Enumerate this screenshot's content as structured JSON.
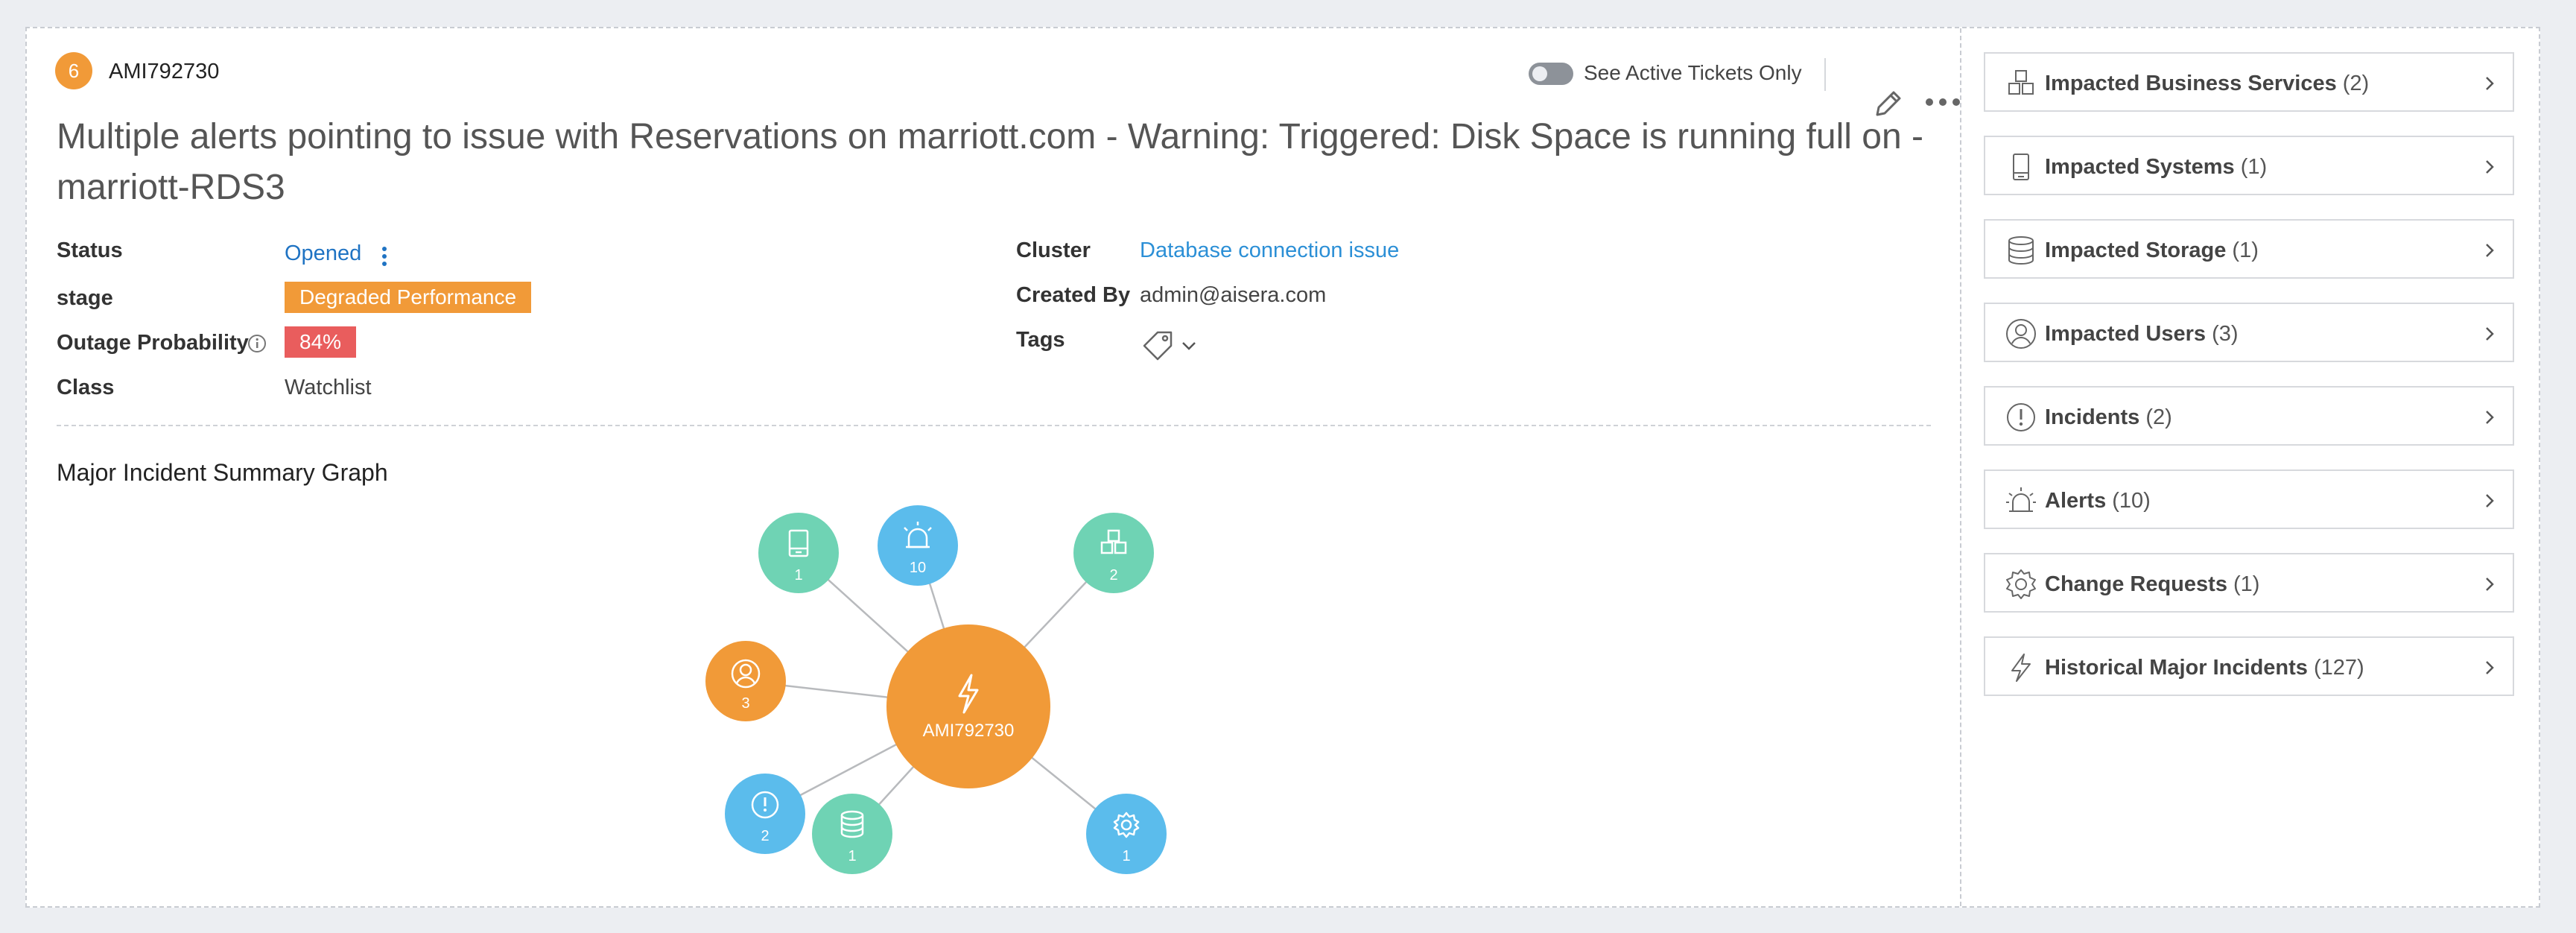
{
  "header": {
    "badge_count": "6",
    "ticket_id": "AMI792730",
    "toggle_label": "See Active Tickets Only",
    "title": "Multiple alerts pointing to issue with Reservations on marriott.com - Warning: Triggered: Disk Space is running full on - marriott-RDS3"
  },
  "fields": {
    "status_label": "Status",
    "status_value": "Opened",
    "stage_label": "stage",
    "stage_value": "Degraded Performance",
    "outage_label": "Outage Probability",
    "outage_value": "84%",
    "class_label": "Class",
    "class_value": "Watchlist",
    "cluster_label": "Cluster",
    "cluster_value": "Database connection issue",
    "created_by_label": "Created By",
    "created_by_value": "admin@aisera.com",
    "tags_label": "Tags"
  },
  "graph": {
    "title": "Major Incident Summary Graph",
    "center_label": "AMI792730",
    "nodes": [
      {
        "name": "systems",
        "icon": "system-icon",
        "count": "1",
        "color": "#6fd3b4"
      },
      {
        "name": "alerts",
        "icon": "alarm-icon",
        "count": "10",
        "color": "#5bbcec"
      },
      {
        "name": "business-services",
        "icon": "cubes-icon",
        "count": "2",
        "color": "#6fd3b4"
      },
      {
        "name": "users",
        "icon": "user-icon",
        "count": "3",
        "color": "#f19a38"
      },
      {
        "name": "incidents",
        "icon": "exclamation-icon",
        "count": "2",
        "color": "#5bbcec"
      },
      {
        "name": "storage",
        "icon": "database-icon",
        "count": "1",
        "color": "#6fd3b4"
      },
      {
        "name": "change-requests",
        "icon": "gear-icon",
        "count": "1",
        "color": "#5bbcec"
      }
    ]
  },
  "side": {
    "items": [
      {
        "label": "Impacted Business Services",
        "count": "(2)",
        "icon": "cubes-icon"
      },
      {
        "label": "Impacted Systems",
        "count": "(1)",
        "icon": "system-icon"
      },
      {
        "label": "Impacted Storage",
        "count": "(1)",
        "icon": "database-icon"
      },
      {
        "label": "Impacted Users",
        "count": "(3)",
        "icon": "user-icon"
      },
      {
        "label": "Incidents",
        "count": "(2)",
        "icon": "exclamation-icon"
      },
      {
        "label": "Alerts",
        "count": "(10)",
        "icon": "alarm-icon"
      },
      {
        "label": "Change Requests",
        "count": "(1)",
        "icon": "gear-icon"
      },
      {
        "label": "Historical Major Incidents",
        "count": "(127)",
        "icon": "lightning-icon"
      }
    ]
  },
  "colors": {
    "orange": "#f19a38",
    "red": "#e95d5d",
    "teal": "#6fd3b4",
    "blue": "#5bbcec",
    "link": "#2b8fd6"
  }
}
